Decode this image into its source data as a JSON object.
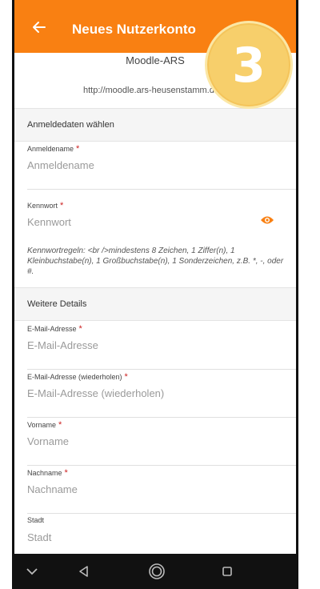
{
  "appbar": {
    "title": "Neues Nutzerkonto"
  },
  "badge": {
    "number": "3"
  },
  "site": {
    "name": "Moodle-ARS",
    "url": "http://moodle.ars-heusenstamm.de"
  },
  "sections": {
    "login": "Anmeldedaten wählen",
    "details": "Weitere Details"
  },
  "fields": {
    "username": {
      "label": "Anmeldename",
      "required": "*",
      "placeholder": "Anmeldename"
    },
    "password": {
      "label": "Kennwort",
      "required": "*",
      "placeholder": "Kennwort"
    },
    "email": {
      "label": "E-Mail-Adresse",
      "required": "*",
      "placeholder": "E-Mail-Adresse"
    },
    "email2": {
      "label": "E-Mail-Adresse (wiederholen)",
      "required": "*",
      "placeholder": "E-Mail-Adresse (wiederholen)"
    },
    "firstname": {
      "label": "Vorname",
      "required": "*",
      "placeholder": "Vorname"
    },
    "lastname": {
      "label": "Nachname",
      "required": "*",
      "placeholder": "Nachname"
    },
    "city": {
      "label": "Stadt",
      "placeholder": "Stadt"
    }
  },
  "password_hint": "Kennwortregeln: <br />mindestens 8 Zeichen, 1 Ziffer(n), 1 Kleinbuchstabe(n), 1 Großbuchstabe(n), 1 Sonderzeichen, z.B. *, -, oder #.",
  "icons": {
    "back": "arrow-left-icon",
    "eye": "eye-icon",
    "nav": [
      "chevron-down-icon",
      "back-triangle-icon",
      "home-circle-icon",
      "recents-square-icon"
    ]
  },
  "colors": {
    "accent": "#f98012",
    "badge": "#f7cf6b",
    "required": "#cc2222",
    "navbar": "#111111"
  }
}
